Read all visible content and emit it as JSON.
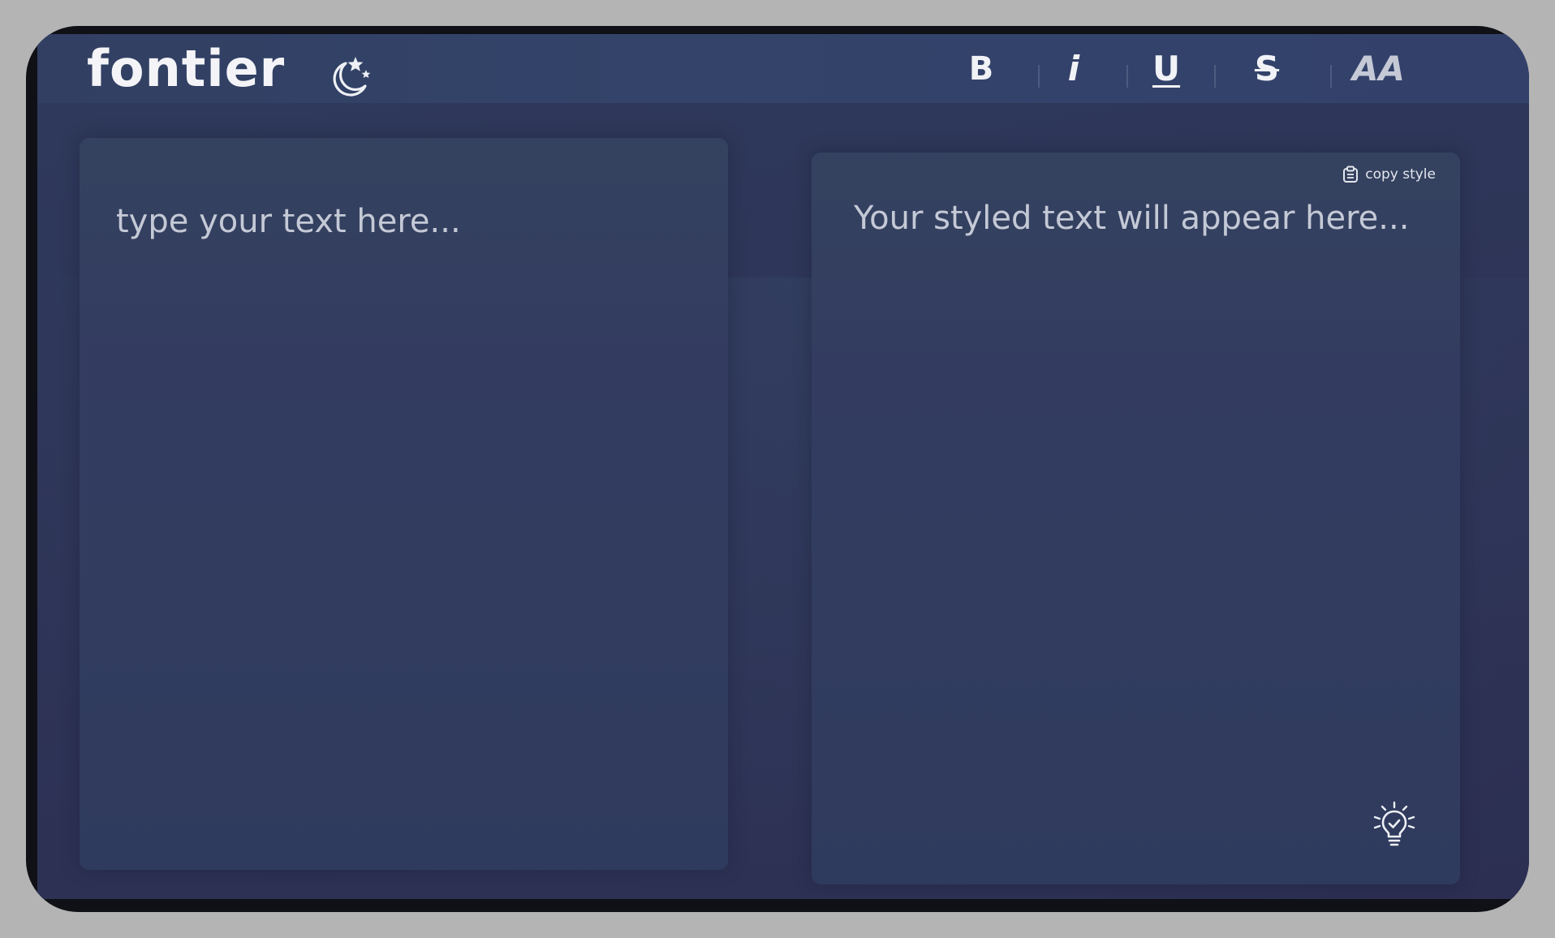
{
  "app": {
    "logo": "fontier"
  },
  "header": {
    "theme_toggle_icon": "moon-stars-icon"
  },
  "toolbar": {
    "bold": "B",
    "italic": "i",
    "underline": "U",
    "strikethrough": "S",
    "caps": "AA"
  },
  "editor": {
    "placeholder": "type your text here...",
    "value": ""
  },
  "output": {
    "placeholder": "Your styled text will appear here...",
    "copy_label": "copy style",
    "copy_icon": "clipboard-icon",
    "tip_icon": "lightbulb-icon"
  },
  "colors": {
    "background": "#2e3558",
    "topbar": "#334369",
    "panel": "#333c60",
    "text": "#f1f2f6",
    "muted_text": "#c4c9d6"
  }
}
